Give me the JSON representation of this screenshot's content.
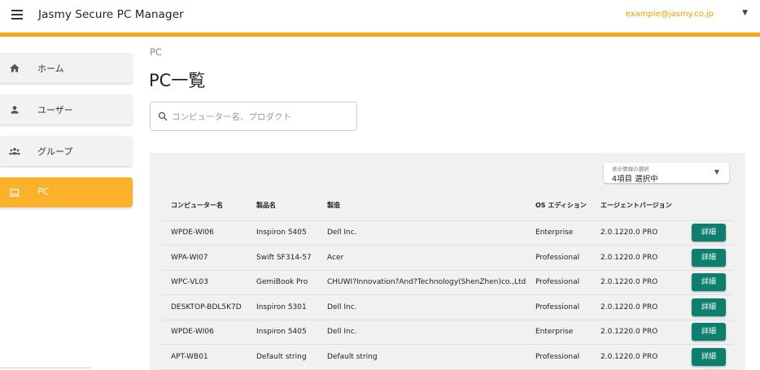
{
  "header": {
    "app_title": "Jasmy Secure PC Manager",
    "user_email": "example@jasmy.co.jp",
    "accent_color": "#f3a51b"
  },
  "sidebar": {
    "items": [
      {
        "label": "ホーム",
        "icon": "home-icon",
        "active": false
      },
      {
        "label": "ユーザー",
        "icon": "person-icon",
        "active": false
      },
      {
        "label": "グループ",
        "icon": "group-icon",
        "active": false
      },
      {
        "label": "PC",
        "icon": "laptop-icon",
        "active": true
      }
    ]
  },
  "main": {
    "breadcrumb": "PC",
    "title": "PC一覧",
    "search_placeholder": "コンピューター名、プロダクト",
    "info_select": {
      "caption": "表示情報の選択",
      "value": "4項目 選択中"
    },
    "table": {
      "headers": [
        "コンピューター名",
        "製品名",
        "製造",
        "OS エディション",
        "エージェントバージョン"
      ],
      "detail_label": "詳細",
      "rows": [
        {
          "name": "WPDE-WI06",
          "product": "Inspiron 5405",
          "maker": "Dell Inc.",
          "os": "Enterprise",
          "agent": "2.0.1220.0 PRO"
        },
        {
          "name": "WPA-WI07",
          "product": "Swift SF314-57",
          "maker": "Acer",
          "os": "Professional",
          "agent": "2.0.1220.0 PRO"
        },
        {
          "name": "WPC-VL03",
          "product": "GemiBook Pro",
          "maker": "CHUWI?Innovation?And?Technology(ShenZhen)co.,Ltd",
          "os": "Professional",
          "agent": "2.0.1220.0 PRO"
        },
        {
          "name": "DESKTOP-BDL5K7D",
          "product": "Inspiron 5301",
          "maker": "Dell Inc.",
          "os": "Professional",
          "agent": "2.0.1220.0 PRO"
        },
        {
          "name": "WPDE-WI06",
          "product": "Inspiron 5405",
          "maker": "Dell Inc.",
          "os": "Enterprise",
          "agent": "2.0.1220.0 PRO"
        },
        {
          "name": "APT-WB01",
          "product": "Default string",
          "maker": "Default string",
          "os": "Professional",
          "agent": "2.0.1220.0 PRO"
        }
      ]
    },
    "detail_button_color": "#0d7f6e"
  }
}
